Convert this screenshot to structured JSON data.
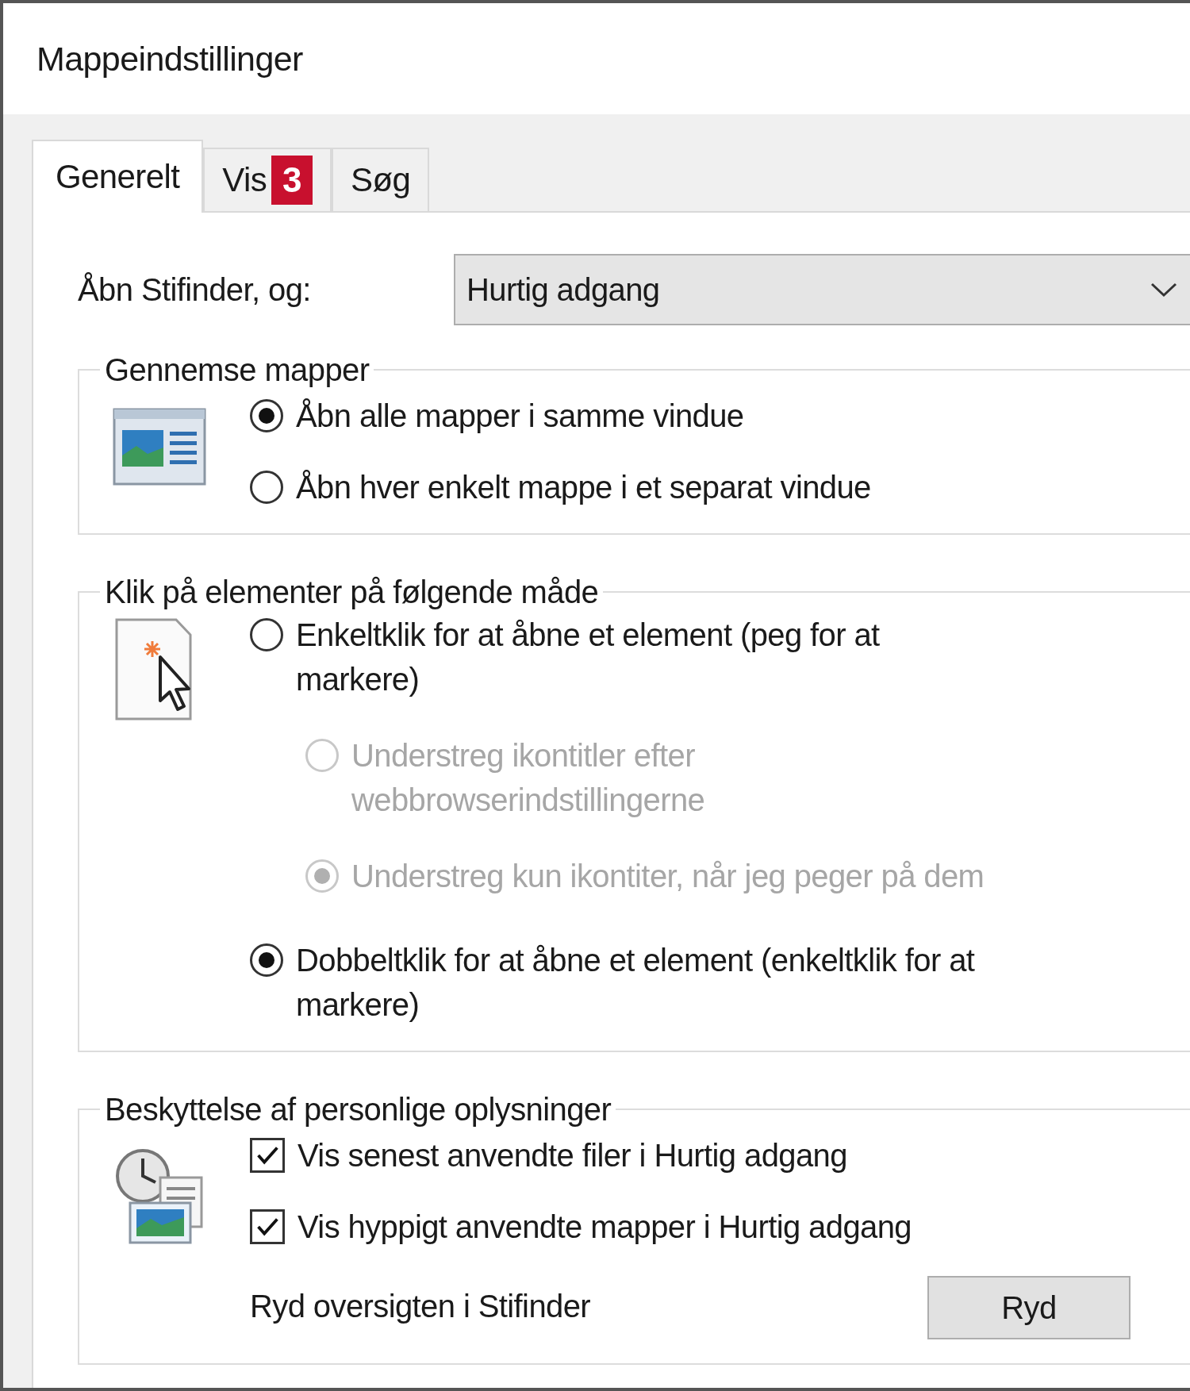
{
  "window": {
    "title": "Mappeindstillinger"
  },
  "tabs": [
    {
      "label": "Generelt",
      "selected": true
    },
    {
      "label": "Vis",
      "selected": false,
      "badge": "3"
    },
    {
      "label": "Søg",
      "selected": false
    }
  ],
  "open_explorer": {
    "label": "Åbn Stifinder, og:",
    "value": "Hurtig adgang"
  },
  "groups": [
    {
      "title": "Gennemse mapper",
      "options": [
        {
          "kind": "radio",
          "label": "Åbn alle mapper i samme vindue",
          "selected": true,
          "disabled": false
        },
        {
          "kind": "radio",
          "label": "Åbn hver enkelt mappe i et separat vindue",
          "selected": false,
          "disabled": false
        }
      ]
    },
    {
      "title": "Klik på elementer på følgende måde",
      "options": [
        {
          "kind": "radio",
          "label": "Enkeltklik for at åbne et element (peg for at markere)",
          "selected": false,
          "disabled": false,
          "children": [
            {
              "label": "Understreg ikontitler efter webbrowserindstillingerne",
              "selected": false,
              "disabled": true
            },
            {
              "label": "Understreg kun ikontiter, når jeg peger på dem",
              "selected": true,
              "disabled": true
            }
          ]
        },
        {
          "kind": "radio",
          "label": "Dobbeltklik for at åbne et element (enkeltklik for at markere)",
          "selected": true,
          "disabled": false
        }
      ]
    },
    {
      "title": "Beskyttelse af personlige oplysninger",
      "options": [
        {
          "kind": "checkbox",
          "label": "Vis senest anvendte filer i Hurtig adgang",
          "checked": true
        },
        {
          "kind": "checkbox",
          "label": "Vis hyppigt anvendte mapper i Hurtig adgang",
          "checked": true
        },
        {
          "kind": "action",
          "label": "Ryd oversigten i Stifinder",
          "button": "Ryd"
        }
      ]
    }
  ]
}
